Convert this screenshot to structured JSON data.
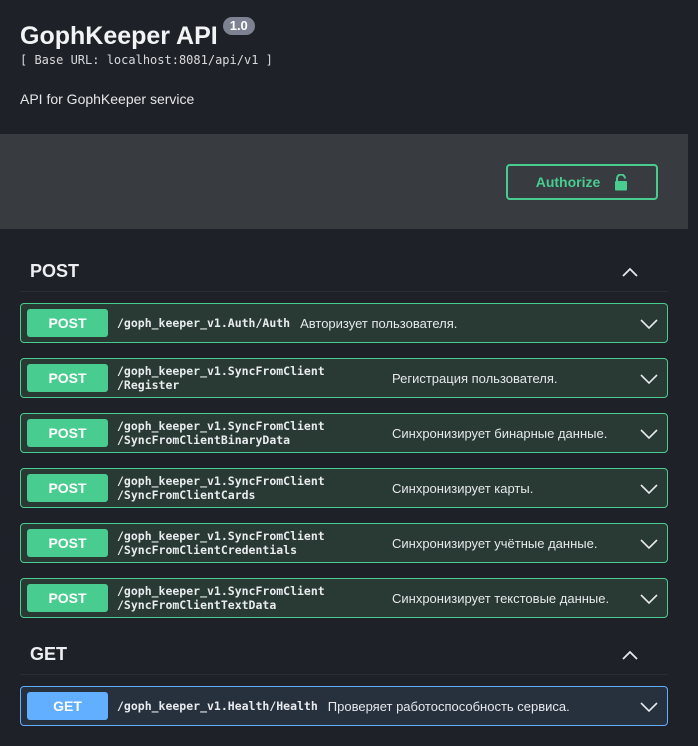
{
  "info": {
    "title": "GophKeeper API",
    "version": "1.0",
    "base_url": "[ Base URL: localhost:8081/api/v1 ]",
    "description": "API for GophKeeper service"
  },
  "auth": {
    "authorize_label": "Authorize"
  },
  "colors": {
    "post": "#49cc90",
    "get": "#61affe"
  },
  "sections": [
    {
      "tag": "POST",
      "operations": [
        {
          "method": "POST",
          "path": "/goph_keeper_v1.Auth/Auth",
          "summary": "Авторизует пользователя."
        },
        {
          "method": "POST",
          "path_line1": "/goph_keeper_v1.SyncFromClient",
          "path_line2": "/Register",
          "summary": "Регистрация пользователя."
        },
        {
          "method": "POST",
          "path_line1": "/goph_keeper_v1.SyncFromClient",
          "path_line2": "/SyncFromClientBinaryData",
          "summary": "Синхронизирует бинарные данные."
        },
        {
          "method": "POST",
          "path_line1": "/goph_keeper_v1.SyncFromClient",
          "path_line2": "/SyncFromClientCards",
          "summary": "Синхронизирует карты."
        },
        {
          "method": "POST",
          "path_line1": "/goph_keeper_v1.SyncFromClient",
          "path_line2": "/SyncFromClientCredentials",
          "summary": "Синхронизирует учётные данные."
        },
        {
          "method": "POST",
          "path_line1": "/goph_keeper_v1.SyncFromClient",
          "path_line2": "/SyncFromClientTextData",
          "summary": "Синхронизирует текстовые данные."
        }
      ]
    },
    {
      "tag": "GET",
      "operations": [
        {
          "method": "GET",
          "path": "/goph_keeper_v1.Health/Health",
          "summary": "Проверяет работоспособность сервиса."
        }
      ]
    }
  ]
}
